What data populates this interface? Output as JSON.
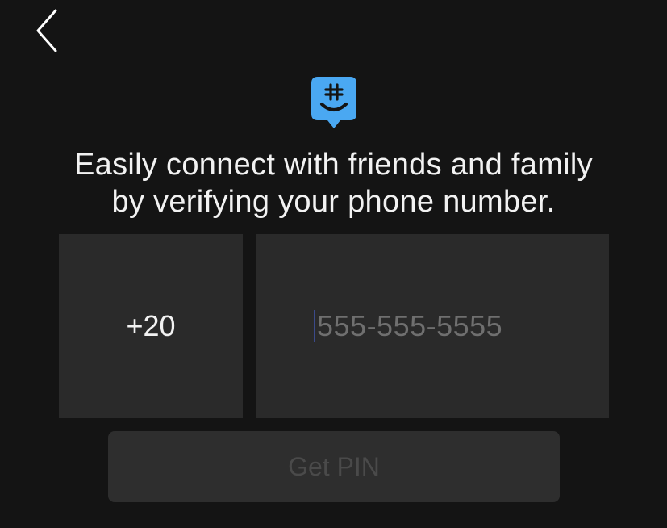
{
  "header": {
    "back_icon": "chevron-left-icon"
  },
  "logo": {
    "icon": "groupme-hashtag-smile-icon",
    "color": "#4aa8f2"
  },
  "headline": {
    "line1": "Easily connect with friends and family",
    "line2": "by verifying your phone number."
  },
  "form": {
    "country_code": "+20",
    "phone_placeholder": "555-555-5555",
    "phone_value": ""
  },
  "actions": {
    "get_pin_label": "Get PIN",
    "get_pin_enabled": false
  },
  "colors": {
    "background": "#141414",
    "field_background": "#2a2a2a",
    "accent": "#4aa8f2"
  }
}
